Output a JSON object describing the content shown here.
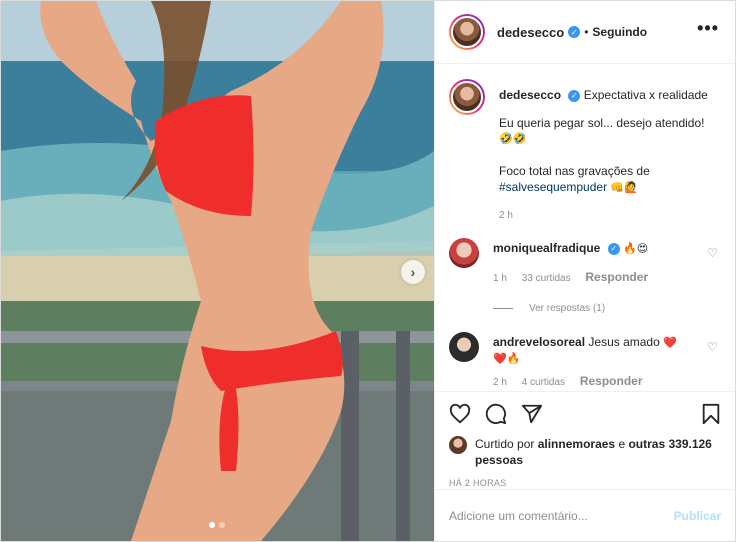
{
  "header": {
    "username": "dedesecco",
    "separator": "•",
    "follow_status": "Seguindo",
    "more_label": "•••"
  },
  "caption": {
    "username": "dedesecco",
    "title": "Expectativa x realidade",
    "line1": "Eu queria pegar sol... desejo atendido!",
    "line1_emoji": "🤣🤣",
    "line2": "Foco total nas gravações de",
    "hashtag": "#salvesequempuder",
    "line2_emoji": "👊🙋",
    "time": "2 h"
  },
  "comments": [
    {
      "username": "moniquealfradique",
      "text": "🔥😍",
      "time": "1 h",
      "likes": "33 curtidas",
      "reply": "Responder",
      "view_replies": "Ver respostas (1)"
    },
    {
      "username": "andrevelosoreal",
      "text": "Jesus amado",
      "emoji": "❤️",
      "emoji2": "❤️🔥",
      "time": "2 h",
      "likes": "4 curtidas",
      "reply": "Responder"
    }
  ],
  "likes": {
    "prefix": "Curtido por",
    "user": "alinnemoraes",
    "middle": "e",
    "others": "outras 339.126 pessoas"
  },
  "timestamp": "HÁ 2 HORAS",
  "comment_box": {
    "placeholder": "Adicione um comentário...",
    "publish": "Publicar"
  },
  "icons": [
    "heart-icon",
    "comment-icon",
    "share-icon",
    "bookmark-icon",
    "verified-icon",
    "chevron-right-icon",
    "more-icon"
  ],
  "colors": {
    "accent": "#3897f0",
    "muted": "#8e8e8e",
    "publish_disabled": "#b2dffc",
    "link": "#00376b"
  }
}
